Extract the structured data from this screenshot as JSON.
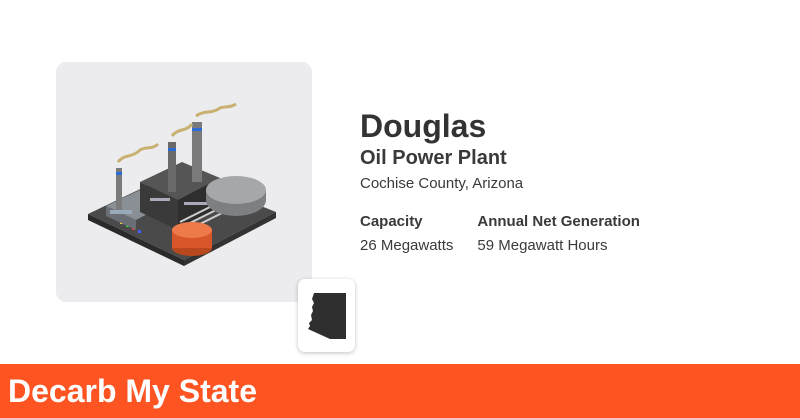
{
  "plant": {
    "name": "Douglas",
    "type": "Oil Power Plant",
    "location": "Cochise County, Arizona"
  },
  "stats": [
    {
      "label": "Capacity",
      "value": "26 Megawatts"
    },
    {
      "label": "Annual Net Generation",
      "value": "59 Megawatt Hours"
    }
  ],
  "footer": {
    "brand": "Decarb My State"
  },
  "icons": {
    "plant_illustration": "oil-power-plant-icon",
    "state_shape": "arizona-state-icon"
  },
  "colors": {
    "accent": "#fd5422",
    "card_background": "#ececef",
    "text": "#3a3a3a"
  }
}
